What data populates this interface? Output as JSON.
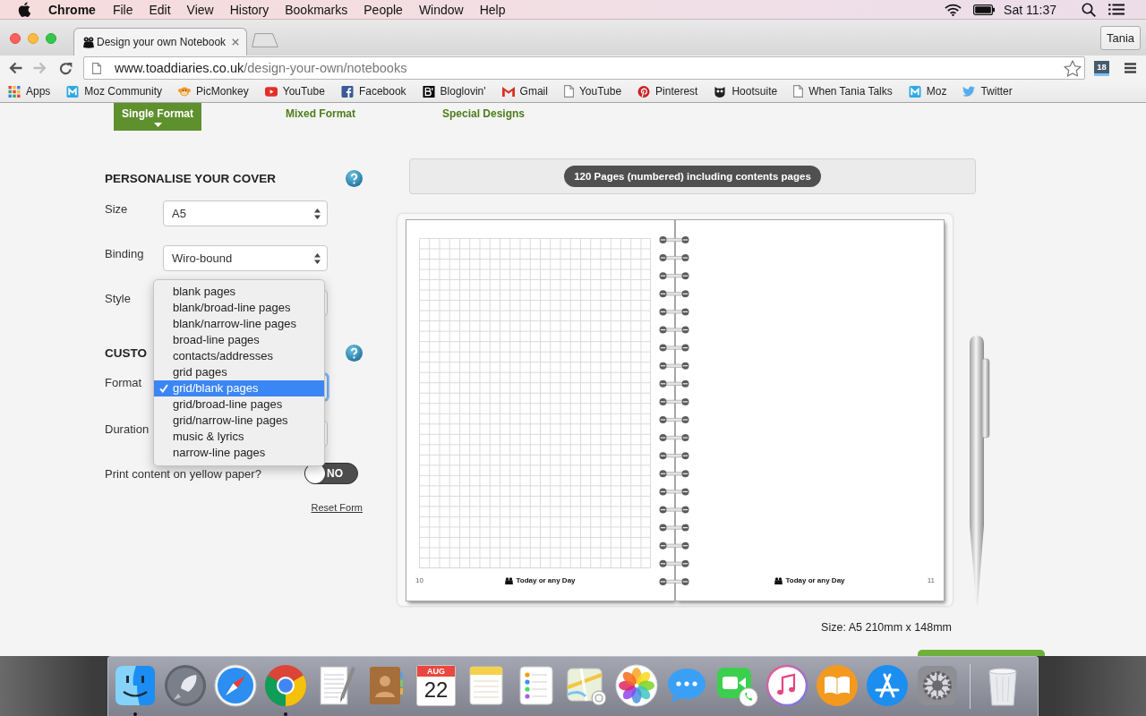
{
  "menubar": {
    "app_name": "Chrome",
    "menus": [
      "File",
      "Edit",
      "View",
      "History",
      "Bookmarks",
      "People",
      "Window",
      "Help"
    ],
    "clock": "Sat 11:37"
  },
  "browser": {
    "tabs": [
      {
        "title": "Design your own Notebook",
        "selected": true
      }
    ],
    "profile": "Tania",
    "nav_buttons": [
      {
        "kind": "back",
        "disabled": false
      },
      {
        "kind": "forward",
        "disabled": true
      },
      {
        "kind": "reload",
        "disabled": false
      }
    ],
    "url_host": "www.toaddiaries.co.uk",
    "url_path": "/design-your-own/notebooks",
    "extension_badge": "18",
    "bookmarks": [
      {
        "kind": "apps",
        "label": "Apps"
      },
      {
        "kind": "moz",
        "label": "Moz Community"
      },
      {
        "kind": "monkey",
        "label": "PicMonkey"
      },
      {
        "kind": "video",
        "label": "YouTube"
      },
      {
        "kind": "facebook",
        "label": "Facebook"
      },
      {
        "kind": "bloglovin",
        "label": "Bloglovin'"
      },
      {
        "kind": "mail",
        "label": "Gmail"
      },
      {
        "kind": "document",
        "label": "YouTube"
      },
      {
        "kind": "pinterest",
        "label": "Pinterest"
      },
      {
        "kind": "owl",
        "label": "Hootsuite"
      },
      {
        "kind": "document",
        "label": "When Tania Talks"
      },
      {
        "kind": "moz",
        "label": "Moz"
      },
      {
        "kind": "bird",
        "label": "Twitter"
      }
    ]
  },
  "page": {
    "nav": [
      {
        "label": "Single Format",
        "selected": true
      },
      {
        "label": "Mixed Format",
        "selected": false
      },
      {
        "label": "Special Designs",
        "selected": false
      }
    ],
    "cover": {
      "heading": "PERSONALISE YOUR COVER",
      "fields": [
        {
          "label": "Size",
          "value": "A5",
          "focused": false
        },
        {
          "label": "Binding",
          "value": "Wiro-bound",
          "focused": false
        },
        {
          "label": "Style",
          "focused": false
        }
      ]
    },
    "content": {
      "heading": "CUSTO",
      "fields": [
        {
          "label": "Format",
          "focused": true,
          "options": [
            {
              "label": "blank pages",
              "selected": false
            },
            {
              "label": "blank/broad-line pages",
              "selected": false
            },
            {
              "label": "blank/narrow-line pages",
              "selected": false
            },
            {
              "label": "broad-line pages",
              "selected": false
            },
            {
              "label": "contacts/addresses",
              "selected": false
            },
            {
              "label": "grid pages",
              "selected": false
            },
            {
              "label": "grid/blank pages",
              "selected": true
            },
            {
              "label": "grid/broad-line pages",
              "selected": false
            },
            {
              "label": "grid/narrow-line pages",
              "selected": false
            },
            {
              "label": "music & lyrics",
              "selected": false
            },
            {
              "label": "narrow-line pages",
              "selected": false
            }
          ]
        },
        {
          "label": "Duration",
          "focused": false
        }
      ]
    },
    "yellow_paper": {
      "label": "Print content on yellow paper?",
      "on": false,
      "state_label": "NO"
    },
    "reset_link": "Reset Form",
    "preview": {
      "pages_badge": "120 Pages (numbered) including contents pages",
      "pages": [
        {
          "kind": "grid",
          "number": "10",
          "footer": "Today or any Day"
        },
        {
          "kind": "blank",
          "number": "11",
          "footer": "Today or any Day"
        }
      ],
      "size_caption": "Size: A5 210mm x 148mm"
    }
  },
  "dock": [
    {
      "kind": "finder",
      "running": true
    },
    {
      "kind": "launchpad",
      "running": false
    },
    {
      "kind": "safari",
      "running": false
    },
    {
      "kind": "chrome",
      "running": true
    },
    {
      "kind": "textedit",
      "running": false
    },
    {
      "kind": "contacts",
      "running": false
    },
    {
      "kind": "calendar",
      "running": false,
      "month": "AUG",
      "day": "22"
    },
    {
      "kind": "notes",
      "running": false
    },
    {
      "kind": "reminders",
      "running": false
    },
    {
      "kind": "maps",
      "running": false
    },
    {
      "kind": "photos",
      "running": false
    },
    {
      "kind": "messages",
      "running": false
    },
    {
      "kind": "facetime",
      "running": false
    },
    {
      "kind": "itunes",
      "running": false
    },
    {
      "kind": "ibooks",
      "running": false
    },
    {
      "kind": "appstore",
      "running": false
    },
    {
      "kind": "preferences",
      "running": false
    },
    {
      "kind": "trash",
      "running": false
    }
  ]
}
